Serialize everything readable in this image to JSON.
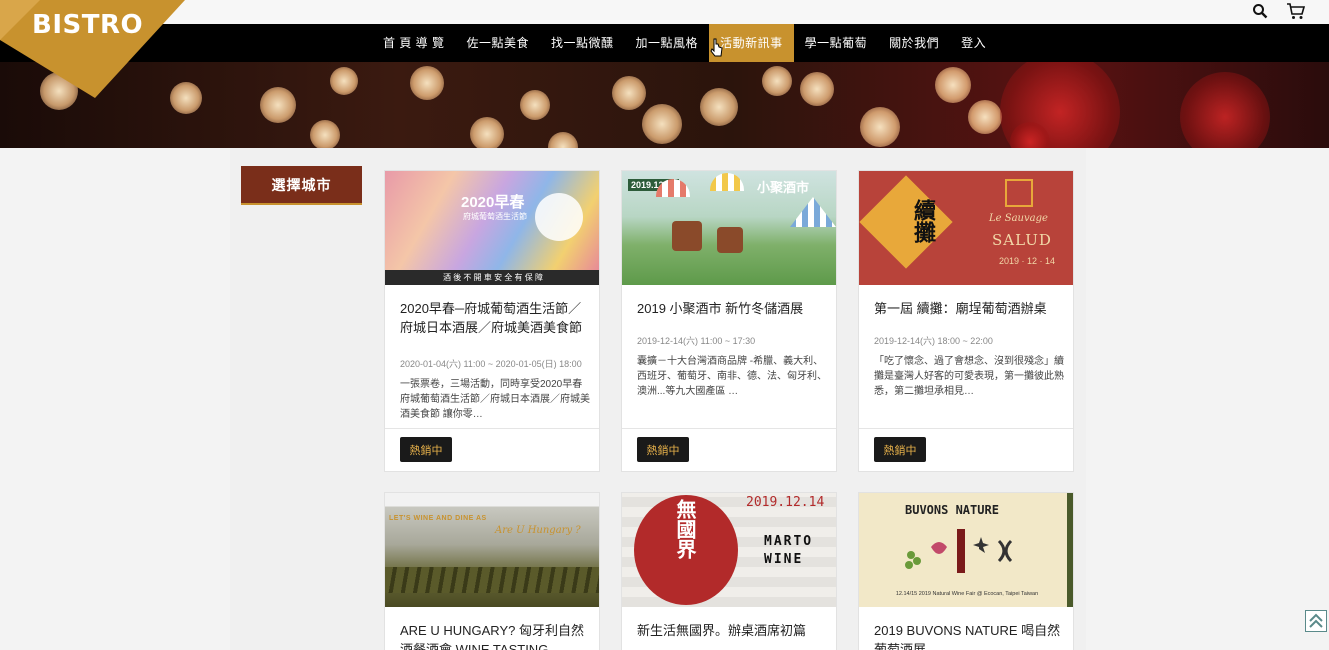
{
  "brand": {
    "logo_text": "BISTRO",
    "accent": "#c8922e",
    "badge_text_color": "#e6b04a"
  },
  "toolbar": {
    "icons": [
      "search-icon",
      "cart-icon"
    ]
  },
  "nav": {
    "items": [
      {
        "label": "首 頁 導 覽",
        "active": false
      },
      {
        "label": "佐一點美食",
        "active": false
      },
      {
        "label": "找一點微醺",
        "active": false
      },
      {
        "label": "加一點風格",
        "active": false
      },
      {
        "label": "活動新訊事",
        "active": true
      },
      {
        "label": "學一點葡萄",
        "active": false
      },
      {
        "label": "關於我們",
        "active": false
      },
      {
        "label": "登入",
        "active": false
      }
    ]
  },
  "sidebar": {
    "city_button": "選擇城市"
  },
  "cards": [
    {
      "title": "2020早春─府城葡萄酒生活節／府城日本酒展／府城美酒美食節",
      "date": "2020-01-04(六) 11:00 ~ 2020-01-05(日) 18:00",
      "desc": "一張票卷，三場活動，同時享受2020早春府城葡萄酒生活節／府城日本酒展／府城美酒美食節 讓你零…",
      "badge": "熱銷中",
      "img_caption": "酒 後 不 開 車   安 全 有 保 障",
      "img_title": "2020早春",
      "img_sub": "府城葡萄酒生活節"
    },
    {
      "title": "2019 小聚酒市 新竹冬儲酒展",
      "date": "2019-12-14(六) 11:00 ~ 17:30",
      "desc": "囊擴－十大台灣酒商品牌 -希臘、義大利、西班牙、葡萄牙、南非、德、法、匈牙利、澳洲...等九大國產區 …",
      "badge": "熱銷中",
      "img_title": "小聚酒市",
      "img_date": "2019.12.14"
    },
    {
      "title": "第一屆 續攤：廟埕葡萄酒辦桌",
      "date": "2019-12-14(六) 18:00 ~ 22:00",
      "desc": "「吃了懷念、過了會想念、沒到很殘念」續攤是臺灣人好客的可愛表現，第一攤彼此熟悉，第二攤坦承相見…",
      "badge": "熱銷中",
      "img_title": "續攤",
      "img_brand": "Le Sauvage",
      "img_brand2": "SALUD",
      "img_date": "2019 · 12 · 14"
    },
    {
      "title": "ARE U HUNGARY? 匈牙利自然酒餐酒會 WINE TASTING",
      "img_top": "LET'S WINE AND DINE AS",
      "img_script": "Are U Hungary ?"
    },
    {
      "title": "新生活無國界。辦桌酒席初篇",
      "img_title": "無國界",
      "img_date": "2019.12.14",
      "img_brand": "MARTO WINE"
    },
    {
      "title": "2019 BUVONS NATURE 喝自然葡萄酒展",
      "img_title": "BUVONS NATURE",
      "img_sub": "12.14/15  2019 Natural Wine Fair @ Ecocan, Taipei Taiwan"
    }
  ]
}
